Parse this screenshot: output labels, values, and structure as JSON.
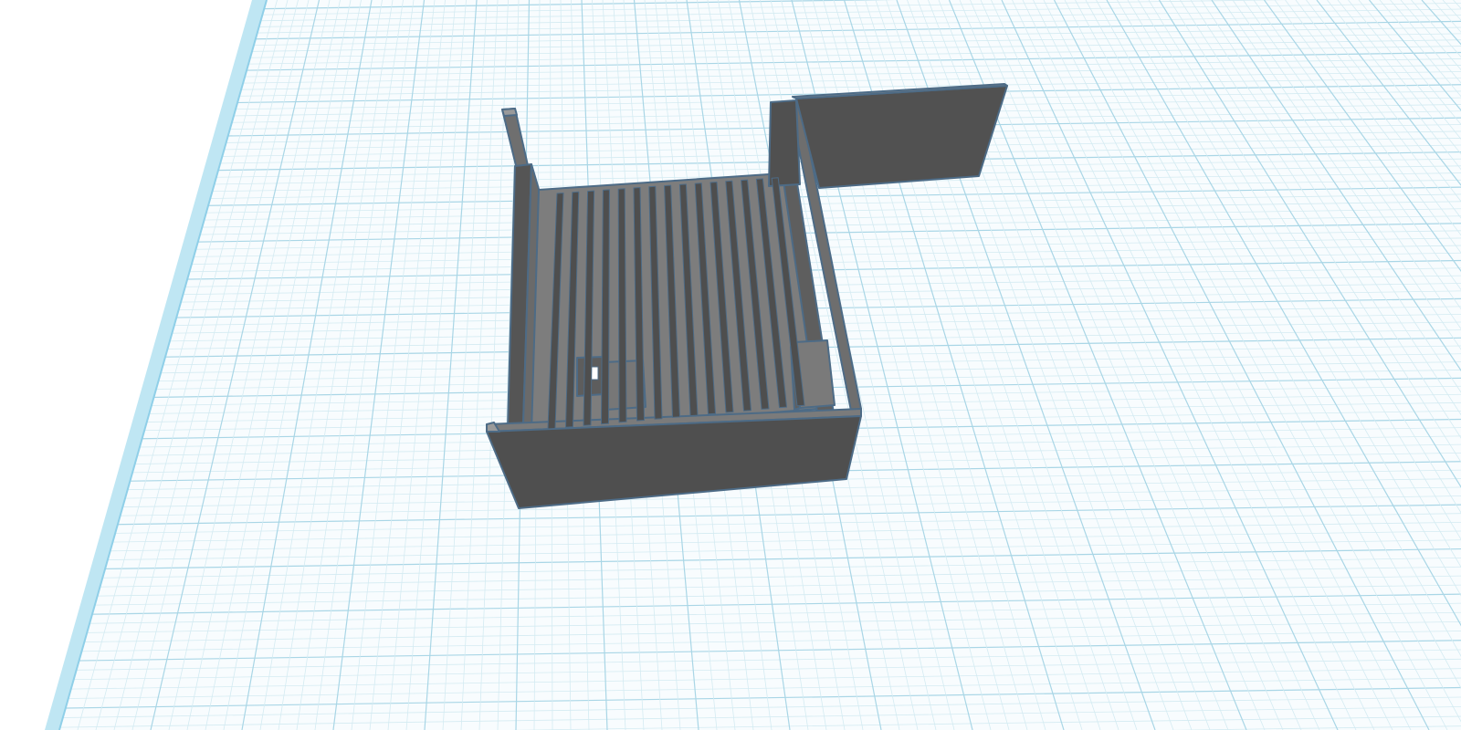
{
  "app": {
    "view": "3D workplane",
    "workplane_visible": true
  },
  "scene": {
    "object_color": "#7d7d7d",
    "object_dark_color": "#4e4e4e",
    "object_edge_color": "#4d6b86",
    "grid_minor_color": "#d4ebf2",
    "grid_major_color": "#a9d6e6",
    "workplane_color": "#f8fcfe",
    "workplane_edge_color": "#8fcfe8",
    "background_color": "#ffffff",
    "objects": [
      "enclosure-base",
      "back-left-post",
      "back-right-panel",
      "front-wall",
      "right-wall",
      "left-wall",
      "floor-ribs",
      "square-mount",
      "side-block"
    ]
  }
}
